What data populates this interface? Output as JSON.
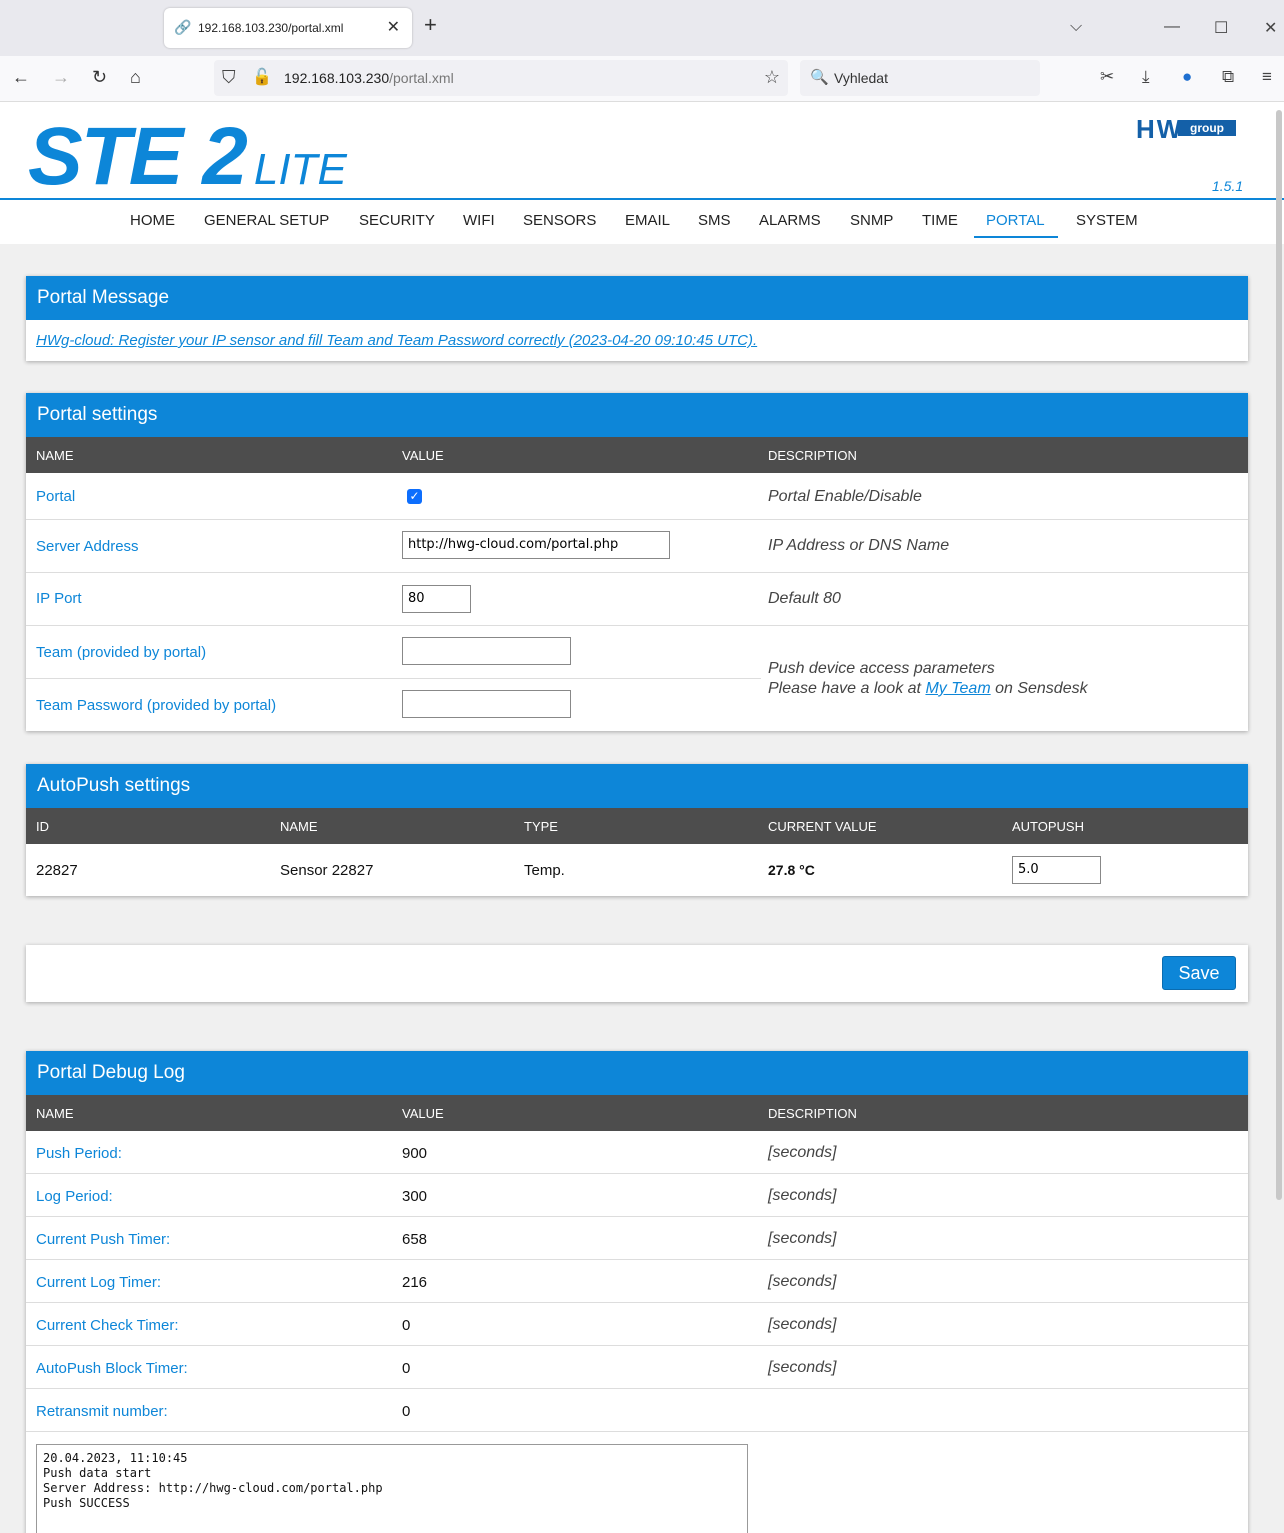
{
  "browser": {
    "tab_title": "192.168.103.230/portal.xml",
    "url_host": "192.168.103.230",
    "url_path": "/portal.xml",
    "search_placeholder": "Vyhledat"
  },
  "header": {
    "logo_main": "STE 2",
    "logo_sub": "LITE",
    "brand_hw": "HW",
    "brand_group": "group",
    "version": "1.5.1"
  },
  "menu": [
    "HOME",
    "GENERAL SETUP",
    "SECURITY",
    "WIFI",
    "SENSORS",
    "EMAIL",
    "SMS",
    "ALARMS",
    "SNMP",
    "TIME",
    "PORTAL",
    "SYSTEM"
  ],
  "menu_active": "PORTAL",
  "portal_message": {
    "title": "Portal Message",
    "text": "HWg-cloud: Register your IP sensor and fill Team and Team Password correctly (2023-04-20 09:10:45 UTC)."
  },
  "portal_settings": {
    "title": "Portal settings",
    "columns": [
      "NAME",
      "VALUE",
      "DESCRIPTION"
    ],
    "rows": {
      "portal": {
        "name": "Portal",
        "checked": true,
        "desc": "Portal Enable/Disable"
      },
      "server": {
        "name": "Server Address",
        "value": "http://hwg-cloud.com/portal.php",
        "desc": "IP Address or DNS Name"
      },
      "port": {
        "name": "IP Port",
        "value": "80",
        "desc": "Default 80"
      },
      "team": {
        "name": "Team (provided by portal)",
        "value": ""
      },
      "team_password": {
        "name": "Team Password (provided by portal)",
        "value": ""
      }
    },
    "push_desc_line1": "Push device access parameters",
    "push_desc_prefix": "Please have a look at ",
    "push_desc_link": "My Team",
    "push_desc_suffix": " on Sensdesk"
  },
  "autopush": {
    "title": "AutoPush settings",
    "columns": [
      "ID",
      "NAME",
      "TYPE",
      "CURRENT VALUE",
      "AUTOPUSH"
    ],
    "row": {
      "id": "22827",
      "name": "Sensor 22827",
      "type": "Temp.",
      "current": "27.8 °C",
      "autopush": "5.0"
    }
  },
  "save_label": "Save",
  "debug": {
    "title": "Portal Debug Log",
    "columns": [
      "NAME",
      "VALUE",
      "DESCRIPTION"
    ],
    "rows": [
      {
        "name": "Push Period:",
        "value": "900",
        "desc": "[seconds]"
      },
      {
        "name": "Log Period:",
        "value": "300",
        "desc": "[seconds]"
      },
      {
        "name": "Current Push Timer:",
        "value": "658",
        "desc": "[seconds]"
      },
      {
        "name": "Current Log Timer:",
        "value": "216",
        "desc": "[seconds]"
      },
      {
        "name": "Current Check Timer:",
        "value": "0",
        "desc": "[seconds]"
      },
      {
        "name": "AutoPush Block Timer:",
        "value": "0",
        "desc": "[seconds]"
      },
      {
        "name": "Retransmit number:",
        "value": "0",
        "desc": ""
      }
    ],
    "log_text": "20.04.2023, 11:10:45\nPush data start\nServer Address: http://hwg-cloud.com/portal.php\nPush SUCCESS"
  }
}
